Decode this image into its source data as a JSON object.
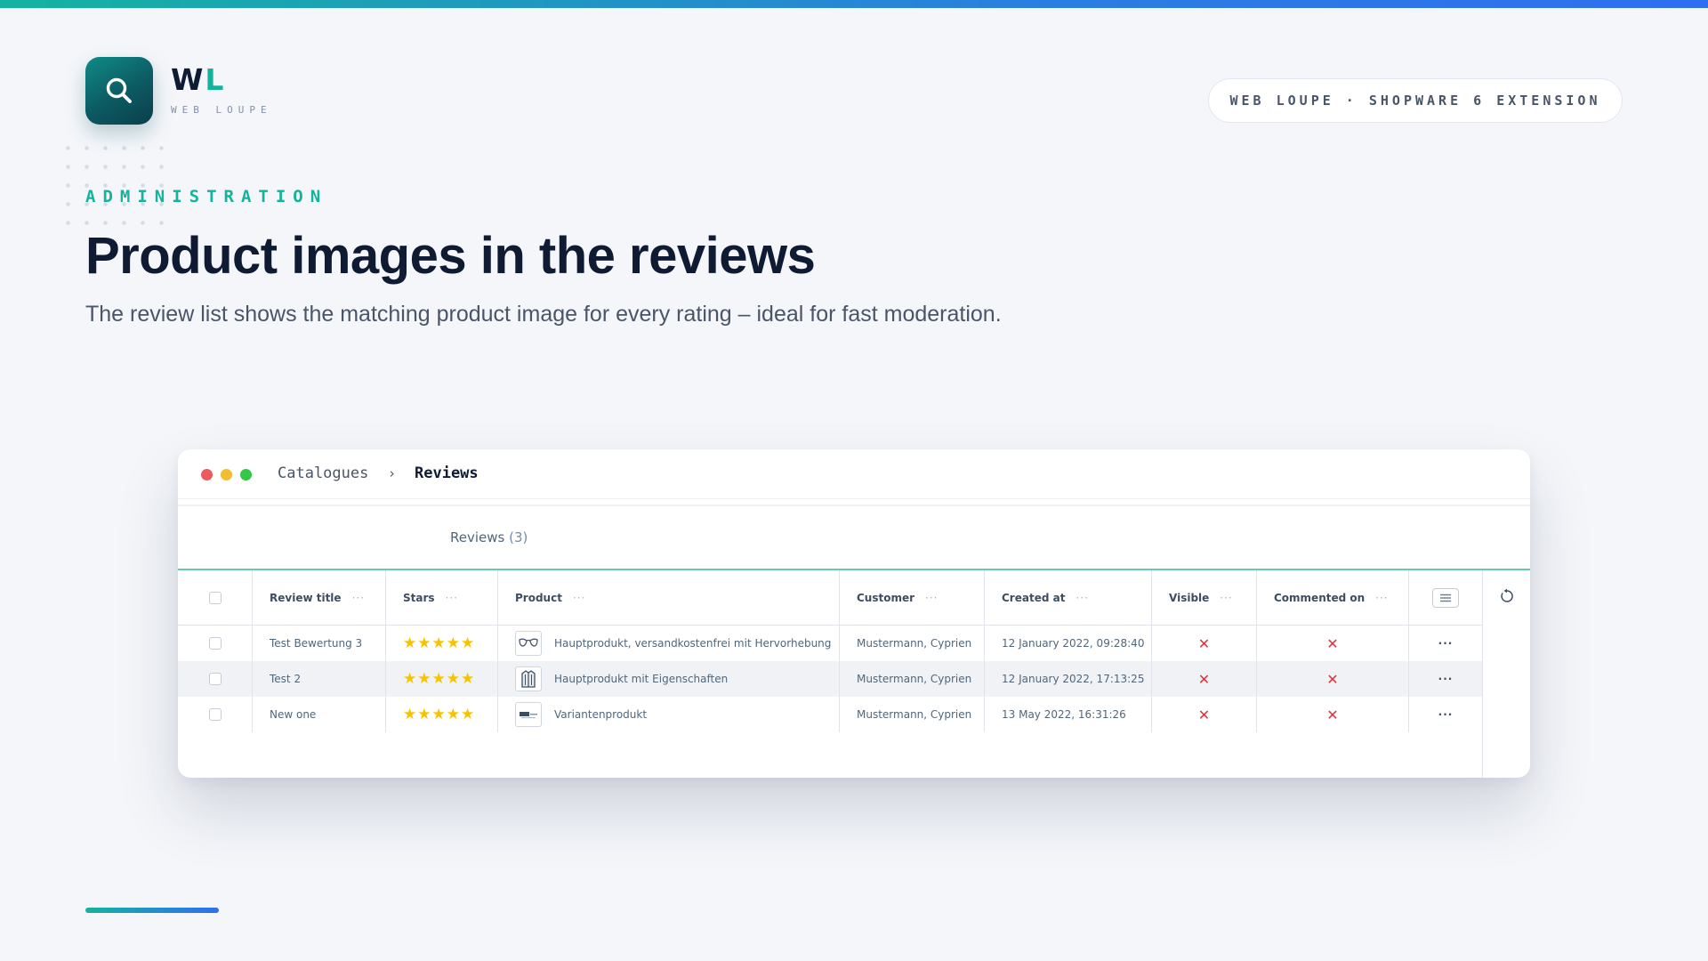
{
  "brand": {
    "logo_letter_1": "W",
    "logo_letter_2": "L",
    "logo_subtitle": "WEB LOUPE",
    "pill_text": "WEB LOUPE · SHOPWARE 6 EXTENSION",
    "accent_color": "#16b39c"
  },
  "hero": {
    "kicker": "ADMINISTRATION",
    "headline": "Product images in the reviews",
    "subline": "The review list shows the matching product image for every rating – ideal for fast moderation."
  },
  "window": {
    "breadcrumb": [
      "Catalogues",
      "Reviews"
    ],
    "breadcrumb_separator": "›",
    "tab": {
      "label": "Reviews",
      "count": "(3)"
    },
    "columns": {
      "title": "Review title",
      "stars": "Stars",
      "product": "Product",
      "customer": "Customer",
      "created": "Created at",
      "visible": "Visible",
      "commented": "Commented on"
    },
    "column_menu": "···",
    "rows": [
      {
        "title": "Test Bewertung 3",
        "stars": 5,
        "product_icon": "glasses-icon",
        "product": "Hauptprodukt, versandkostenfrei mit Hervorhebung",
        "customer": "Mustermann, Cyprien",
        "created": "12 January 2022, 09:28:40",
        "visible": "✕",
        "commented": "✕",
        "actions": "···"
      },
      {
        "title": "Test 2",
        "stars": 5,
        "product_icon": "jacket-icon",
        "product": "Hauptprodukt mit Eigenschaften",
        "customer": "Mustermann, Cyprien",
        "created": "12 January 2022, 17:13:25",
        "visible": "✕",
        "commented": "✕",
        "actions": "···"
      },
      {
        "title": "New one",
        "stars": 5,
        "product_icon": "logo-thumb-icon",
        "product": "Variantenprodukt",
        "customer": "Mustermann, Cyprien",
        "created": "13 May 2022, 16:31:26",
        "visible": "✕",
        "commented": "✕",
        "actions": "···"
      }
    ]
  }
}
